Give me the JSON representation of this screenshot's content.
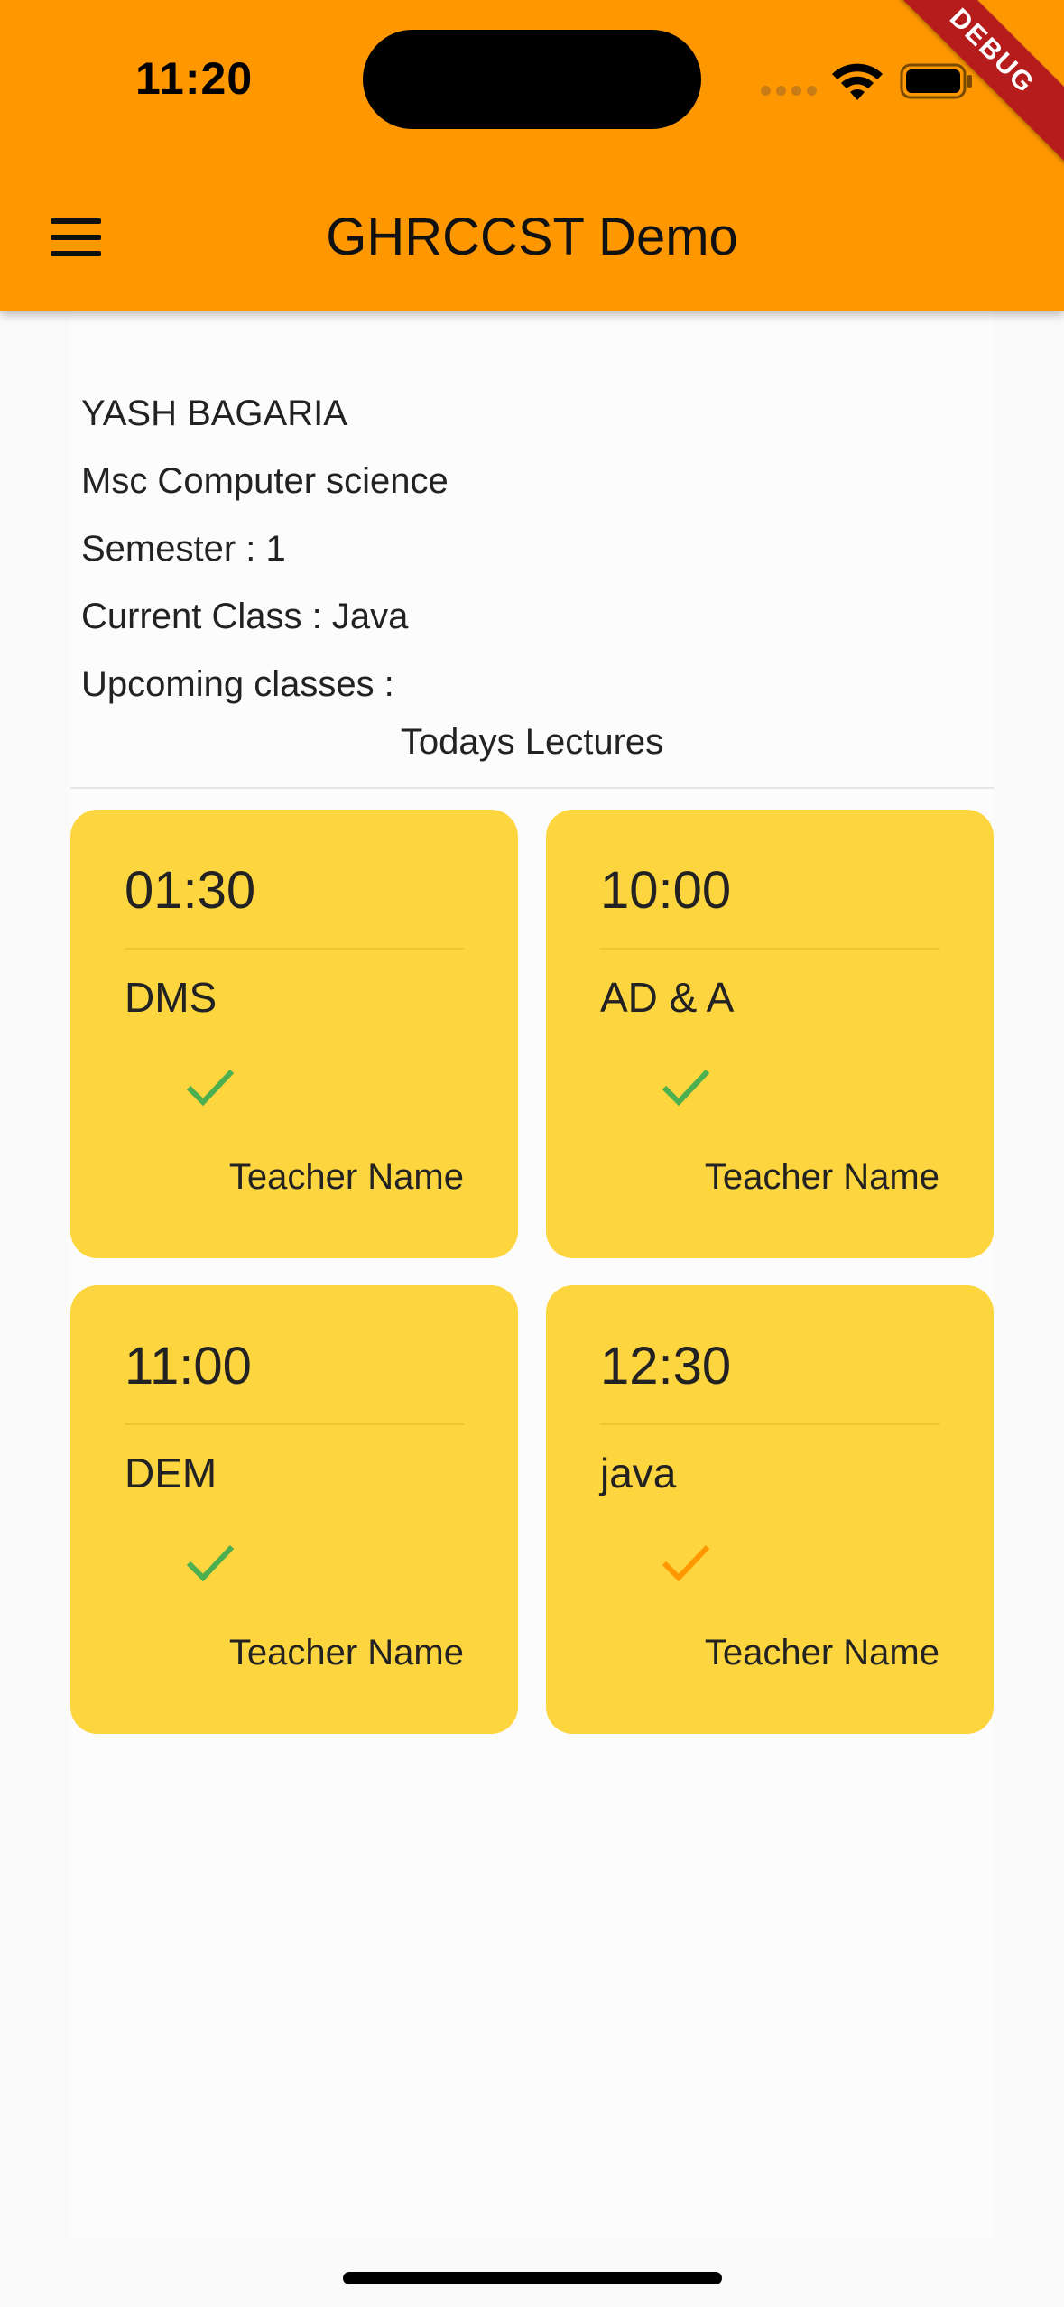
{
  "status_bar": {
    "time": "11:20"
  },
  "debug_banner": "DEBUG",
  "app_bar": {
    "title": "GHRCCST Demo"
  },
  "profile": {
    "name": "YASH BAGARIA",
    "course": "Msc Computer science",
    "semester": "Semester : 1",
    "current_class": "Current Class : Java",
    "upcoming": "Upcoming classes :"
  },
  "section_title": "Todays Lectures",
  "lectures": [
    {
      "time": "01:30",
      "subject": "DMS",
      "teacher": "Teacher Name",
      "status_icon": "check-icon",
      "status_color": "#4caf50"
    },
    {
      "time": "10:00",
      "subject": "AD & A",
      "teacher": "Teacher Name",
      "status_icon": "check-icon",
      "status_color": "#4caf50"
    },
    {
      "time": "11:00",
      "subject": "DEM",
      "teacher": "Teacher Name",
      "status_icon": "check-icon",
      "status_color": "#4caf50"
    },
    {
      "time": "12:30",
      "subject": "java",
      "teacher": "Teacher Name",
      "status_icon": "check-icon",
      "status_color": "#ff9800"
    }
  ],
  "colors": {
    "app_bar": "#ff9800",
    "card": "#fdd53f",
    "debug": "#b71c1c"
  }
}
